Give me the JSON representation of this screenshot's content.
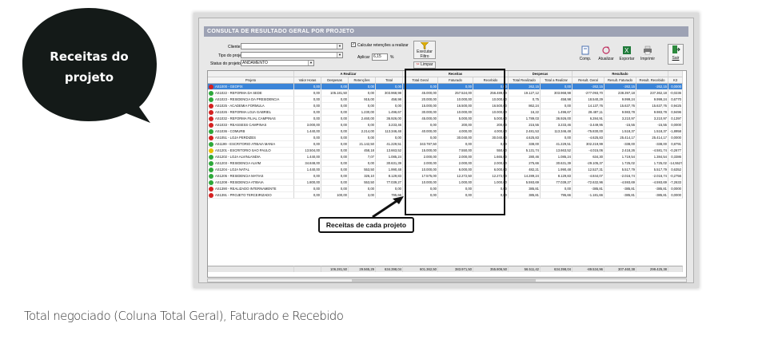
{
  "bubble": {
    "line1": "Receitas do",
    "line2": "projeto"
  },
  "caption": "Total negociado (Coluna Total Geral), Faturado e Recebido",
  "callout": "Receitas de cada projeto",
  "window": {
    "title": "CONSULTA DE RESULTADO GERAL POR PROJETO",
    "filters": {
      "cliente_label": "Cliente",
      "cliente_value": "",
      "tipo_label": "Tipo do projeto",
      "tipo_value": "",
      "status_label": "Status do projeto",
      "status_value": "ANDAMENTO",
      "calc_label": "Calcular retenções a realizar",
      "aplicar_label": "Aplicar",
      "aplicar_value": "6,15",
      "pct": "%"
    },
    "buttons": {
      "executar": "Executar Filtro",
      "limpar": "Limpar",
      "comp": "Comp.",
      "atualizar": "Atualizar",
      "exportar": "Exportar",
      "imprimir": "Imprimir",
      "sair": "Sair"
    },
    "groups": [
      "A Realizar",
      "Receitas",
      "Despesas",
      "Resultado"
    ],
    "columns": [
      "Projeto",
      "Valor Horas",
      "Despesas",
      "Retenções",
      "Total",
      "Total Geral",
      "Faturado",
      "Recebido",
      "Total Realizado",
      "Total a Realizar",
      "Result. Geral",
      "Result. Faturado",
      "Result. Recebido",
      "K3"
    ],
    "rows": [
      {
        "status": "red",
        "cells": [
          "AS1000 - GEOPIX",
          "0,00",
          "0,00",
          "0,00",
          "0,00",
          "0,00",
          "0,00",
          "0,00",
          "262,15",
          "0,00",
          "-262,15",
          "-262,15",
          "-262,15",
          "0,0000"
        ],
        "sel": true
      },
      {
        "status": "green",
        "cells": [
          "AS1022 - REFORMA DA SEDE",
          "0,00",
          "105.181,50",
          "0,00",
          "303.968,98",
          "45.000,00",
          "257.524,00",
          "256.489,00",
          "19.127,12",
          "303.968,98",
          "-277.093,70",
          "238.397,18",
          "237.362,18",
          "-0,0236"
        ]
      },
      {
        "status": "green",
        "cells": [
          "AS1023 - RESIDENCIA DA PRESIDENCIA",
          "0,00",
          "0,00",
          "915,00",
          "458,98",
          "20.000,00",
          "10.000,00",
          "10.000,00",
          "0,75",
          "458,98",
          "18.540,29",
          "9.999,24",
          "9.999,24",
          "0,6770"
        ]
      },
      {
        "status": "red",
        "cells": [
          "AS1025 - ACADEMIA FORMULA",
          "0,00",
          "0,00",
          "0,00",
          "0,00",
          "15.000,00",
          "16.500,00",
          "16.500,00",
          "862,24",
          "0,00",
          "14.137,76",
          "15.637,76",
          "15.637,76",
          "0,9425"
        ]
      },
      {
        "status": "red",
        "cells": [
          "AS1026 - REFORMA LOJA GABRIEL",
          "0,00",
          "0,00",
          "1.230,00",
          "1.496,67",
          "30.000,00",
          "10.000,00",
          "10.000,00",
          "16,22",
          "1.496,67",
          "28.487,11",
          "9.983,78",
          "9.983,78",
          "0,9496"
        ]
      },
      {
        "status": "red",
        "cells": [
          "AS1032 - REFORMA FILIAL CAMPINAS",
          "0,00",
          "0,00",
          "2.460,00",
          "36.926,00",
          "45.000,00",
          "5.000,00",
          "5.000,00",
          "1.789,03",
          "36.926,00",
          "6.284,91",
          "3.210,97",
          "3.210,97",
          "0,1397"
        ]
      },
      {
        "status": "red",
        "cells": [
          "AS1033 - REASSESS CAMPINAS",
          "3.000,00",
          "0,00",
          "0,00",
          "3.233,46",
          "0,00",
          "200,00",
          "200,00",
          "215,55",
          "3.233,46",
          "-3.449,95",
          "-15,55",
          "-15,55",
          "0,0000"
        ]
      },
      {
        "status": "green",
        "cells": [
          "AS1036 - COMURB",
          "1.440,00",
          "0,00",
          "2.214,00",
          "113.346,48",
          "40.000,00",
          "4.000,00",
          "4.000,00",
          "2.481,53",
          "113.346,48",
          "-75.830,00",
          "1.518,37",
          "1.518,37",
          "-1,8958"
        ]
      },
      {
        "status": "red",
        "cells": [
          "AS1051 - LOJA PERDIZES",
          "0,00",
          "0,00",
          "0,00",
          "0,00",
          "0,00",
          "30.040,00",
          "30.040,00",
          "4.625,83",
          "0,00",
          "-4.625,83",
          "25.414,17",
          "25.414,17",
          "0,0000"
        ]
      },
      {
        "status": "green",
        "cells": [
          "AS1199 - ESCRITORIO ATIBAIA MANIA",
          "0,00",
          "0,00",
          "21.142,50",
          "41.229,51",
          "343.787,50",
          "0,00",
          "0,00",
          "338,00",
          "41.229,51",
          "302.219,99",
          "-338,00",
          "-338,00",
          "0,8791"
        ]
      },
      {
        "status": "yellow",
        "cells": [
          "AS1201 - ESCRITORIO SAO PAULO",
          "13.504,00",
          "0,00",
          "458,18",
          "13.663,52",
          "15.000,00",
          "7.550,00",
          "550,00",
          "5.131,74",
          "13.663,52",
          "-4.015,06",
          "2.418,26",
          "-4.581,74",
          "-0,2677"
        ]
      },
      {
        "status": "green",
        "cells": [
          "AS1202 - LOJA ALVINLANDIA",
          "1.440,00",
          "0,00",
          "7,07",
          "1.085,24",
          "2.000,00",
          "2.000,00",
          "1.665,00",
          "280,46",
          "1.085,24",
          "634,30",
          "1.719,54",
          "1.384,54",
          "0,3386"
        ]
      },
      {
        "status": "green",
        "cells": [
          "AS1203 - RESIDENCIA ALVIM",
          "34.848,00",
          "0,00",
          "0,00",
          "30.631,39",
          "2.000,00",
          "2.000,00",
          "2.000,00",
          "275,66",
          "30.631,39",
          "-29.105,37",
          "1.725,02",
          "1.725,02",
          "-14,5527"
        ]
      },
      {
        "status": "green",
        "cells": [
          "AS1204 - LOJA NATAL",
          "1.440,00",
          "0,00",
          "553,50",
          "1.990,48",
          "10.000,00",
          "6.000,00",
          "6.000,00",
          "482,21",
          "1.990,48",
          "12.527,31",
          "5.517,79",
          "5.517,79",
          "0,6352"
        ]
      },
      {
        "status": "green",
        "cells": [
          "AS1205 - RESIDENCIA MATIAS",
          "0,00",
          "0,00",
          "326,10",
          "8.129,83",
          "17.575,00",
          "12.272,50",
          "12.272,50",
          "14.289,24",
          "8.129,83",
          "-4.844,07",
          "-2.016,74",
          "-2.016,74",
          "-0,2756"
        ]
      },
      {
        "status": "green",
        "cells": [
          "AS1208 - RESIDENCIA ATIBAIA",
          "1.800,00",
          "0,00",
          "553,50",
          "77.039,27",
          "10.000,00",
          "1.000,00",
          "1.000,00",
          "5.593,69",
          "77.039,27",
          "-72.632,96",
          "-4.593,69",
          "-4.593,69",
          "-7,2633"
        ]
      },
      {
        "status": "red",
        "cells": [
          "AS1390 - REALIZADO INTERNAMENTE",
          "0,00",
          "0,00",
          "0,00",
          "0,00",
          "0,00",
          "0,00",
          "0,00",
          "385,81",
          "0,00",
          "-385,81",
          "-385,81",
          "-385,81",
          "0,0000"
        ]
      },
      {
        "status": "red",
        "cells": [
          "AS1391 - PROJETO TERCEIRIZADO",
          "0,00",
          "100,00",
          "3,00",
          "795,66",
          "0,00",
          "0,00",
          "0,00",
          "385,81",
          "795,66",
          "-1.181,66",
          "-385,81",
          "-385,81",
          "0,0000"
        ]
      }
    ],
    "totals": [
      "",
      "",
      "106.281,50",
      "29.565,29",
      "634.398,04",
      "601.362,50",
      "383.971,50",
      "355.806,50",
      "56.511,42",
      "634.398,04",
      "-89.534,96",
      "307.460,38",
      "299.425,38",
      ""
    ]
  }
}
